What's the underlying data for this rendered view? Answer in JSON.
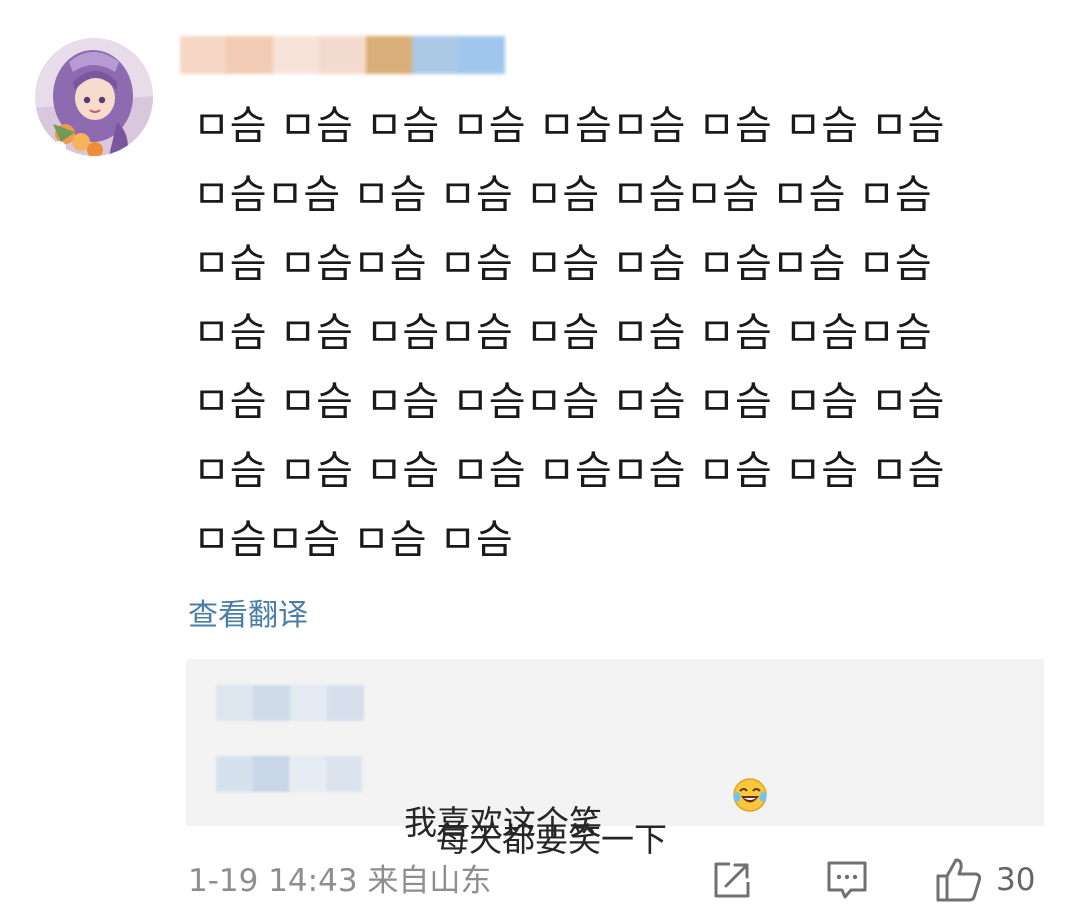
{
  "comment": {
    "lines": [
      "ㅁ슴 ㅁ슴 ㅁ슴 ㅁ슴 ㅁ슴ㅁ슴 ㅁ슴 ㅁ슴 ㅁ슴",
      "ㅁ슴ㅁ슴 ㅁ슴 ㅁ슴 ㅁ슴 ㅁ슴ㅁ슴 ㅁ슴 ㅁ슴",
      "ㅁ슴 ㅁ슴ㅁ슴 ㅁ슴 ㅁ슴 ㅁ슴 ㅁ슴ㅁ슴 ㅁ슴",
      "ㅁ슴 ㅁ슴 ㅁ슴ㅁ슴 ㅁ슴 ㅁ슴 ㅁ슴 ㅁ슴ㅁ슴",
      "ㅁ슴 ㅁ슴 ㅁ슴 ㅁ슴ㅁ슴 ㅁ슴 ㅁ슴 ㅁ슴 ㅁ슴",
      "ㅁ슴 ㅁ슴 ㅁ슴 ㅁ슴 ㅁ슴ㅁ슴 ㅁ슴 ㅁ슴 ㅁ슴",
      "ㅁ슴ㅁ슴 ㅁ슴 ㅁ슴"
    ],
    "translate_link": "查看翻译"
  },
  "replies": [
    {
      "text": "每天都要笑一下",
      "emoji": "laughing-tears-emoji"
    },
    {
      "text": "我喜欢这个笑"
    }
  ],
  "footer": {
    "meta": "1-19 14:43 来自山东",
    "like_count": "30"
  },
  "icons": {
    "share": "share-icon",
    "comment": "comment-icon",
    "like": "thumbs-up-icon"
  },
  "colors": {
    "link": "#4a7ea6",
    "reply_background": "#f3f3f3",
    "meta_text": "#8e8e8e"
  }
}
